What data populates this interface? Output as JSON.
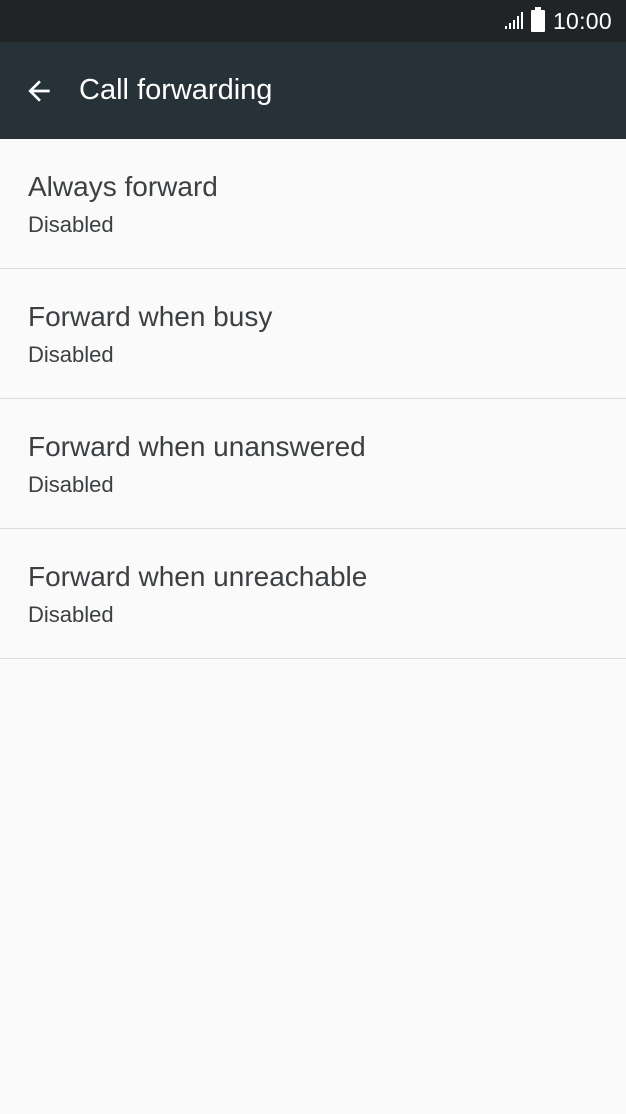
{
  "status_bar": {
    "time": "10:00",
    "icons": [
      "signal-icon",
      "battery-icon"
    ]
  },
  "app_bar": {
    "back_icon": "arrow-back-icon",
    "title": "Call forwarding"
  },
  "colors": {
    "status_bar_bg": "#202426",
    "app_bar_bg": "#263238",
    "page_bg": "#fafafa",
    "text": "#3c4043",
    "divider": "#dcdcdc"
  },
  "settings": {
    "items": [
      {
        "title": "Always forward",
        "summary": "Disabled"
      },
      {
        "title": "Forward when busy",
        "summary": "Disabled"
      },
      {
        "title": "Forward when unanswered",
        "summary": "Disabled"
      },
      {
        "title": "Forward when unreachable",
        "summary": "Disabled"
      }
    ]
  }
}
